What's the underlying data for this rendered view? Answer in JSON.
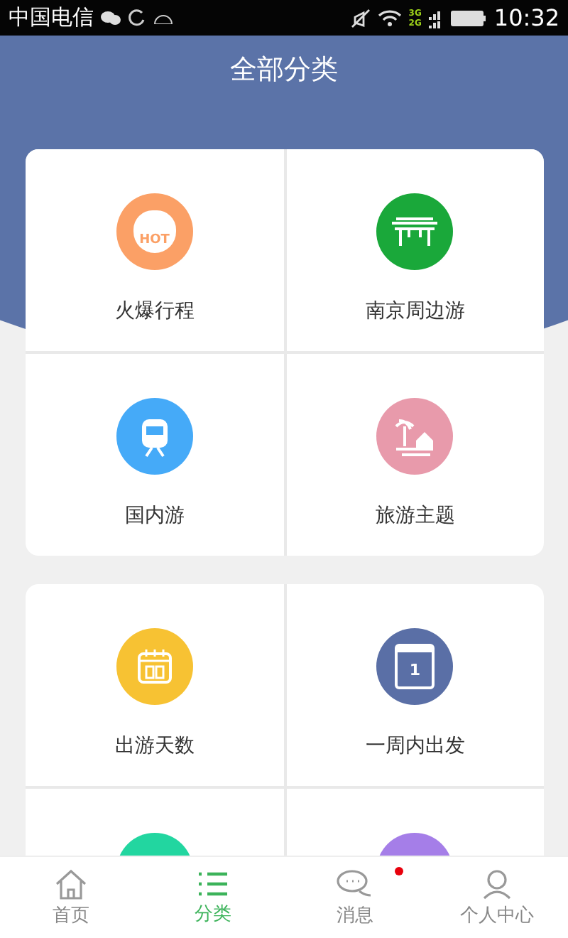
{
  "status_bar": {
    "carrier": "中国电信",
    "network_top": "3G",
    "network_bottom": "2G",
    "time": "10:32"
  },
  "header": {
    "title": "全部分类"
  },
  "sections": [
    {
      "items": [
        {
          "label": "火爆行程",
          "kind": "hot",
          "icon_text": "HOT",
          "color": "#fba066"
        },
        {
          "label": "南京周边游",
          "kind": "gate",
          "color": "#1aa83a"
        },
        {
          "label": "国内游",
          "kind": "train",
          "color": "#45aaf8"
        },
        {
          "label": "旅游主题",
          "kind": "island",
          "color": "#e89aab"
        }
      ]
    },
    {
      "items": [
        {
          "label": "出游天数",
          "kind": "calendar_grid",
          "color": "#f7c233"
        },
        {
          "label": "一周内出发",
          "kind": "calendar_day",
          "icon_text": "1",
          "color": "#5a6fa6"
        },
        {
          "kind": "plain",
          "color": "#22d6a0"
        },
        {
          "kind": "plain",
          "color": "#a57ee8"
        }
      ]
    }
  ],
  "tab_bar": [
    {
      "label": "首页",
      "kind": "home",
      "selected": false,
      "badge": false
    },
    {
      "label": "分类",
      "kind": "list",
      "selected": true,
      "badge": false
    },
    {
      "label": "消息",
      "kind": "chat",
      "selected": false,
      "badge": true
    },
    {
      "label": "个人中心",
      "kind": "person",
      "selected": false,
      "badge": false
    }
  ]
}
